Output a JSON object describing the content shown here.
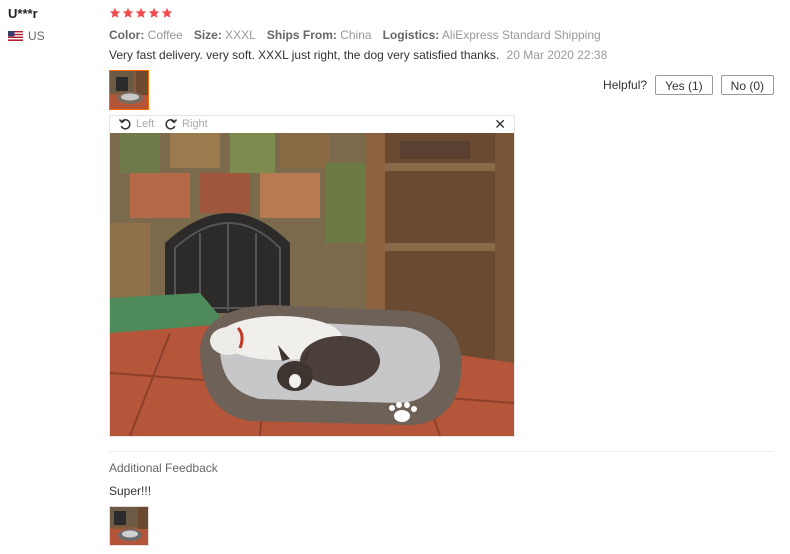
{
  "user": {
    "name": "U***r",
    "country": "US"
  },
  "review": {
    "stars": 5,
    "star_color": "#f04e4e",
    "attributes": [
      {
        "key": "Color:",
        "value": "Coffee"
      },
      {
        "key": "Size:",
        "value": "XXXL"
      },
      {
        "key": "Ships From:",
        "value": "China"
      },
      {
        "key": "Logistics:",
        "value": "AliExpress Standard Shipping"
      }
    ],
    "text": "Very fast delivery. very soft. XXXL just right, the dog very satisfied thanks.",
    "date": "20 Mar 2020 22:38"
  },
  "helpful": {
    "label": "Helpful?",
    "yes_label": "Yes (1)",
    "no_label": "No (0)"
  },
  "viewer": {
    "rotate_left_label": "Left",
    "rotate_right_label": "Right",
    "close_icon": "close-icon"
  },
  "additional": {
    "title": "Additional Feedback",
    "text": "Super!!!"
  }
}
